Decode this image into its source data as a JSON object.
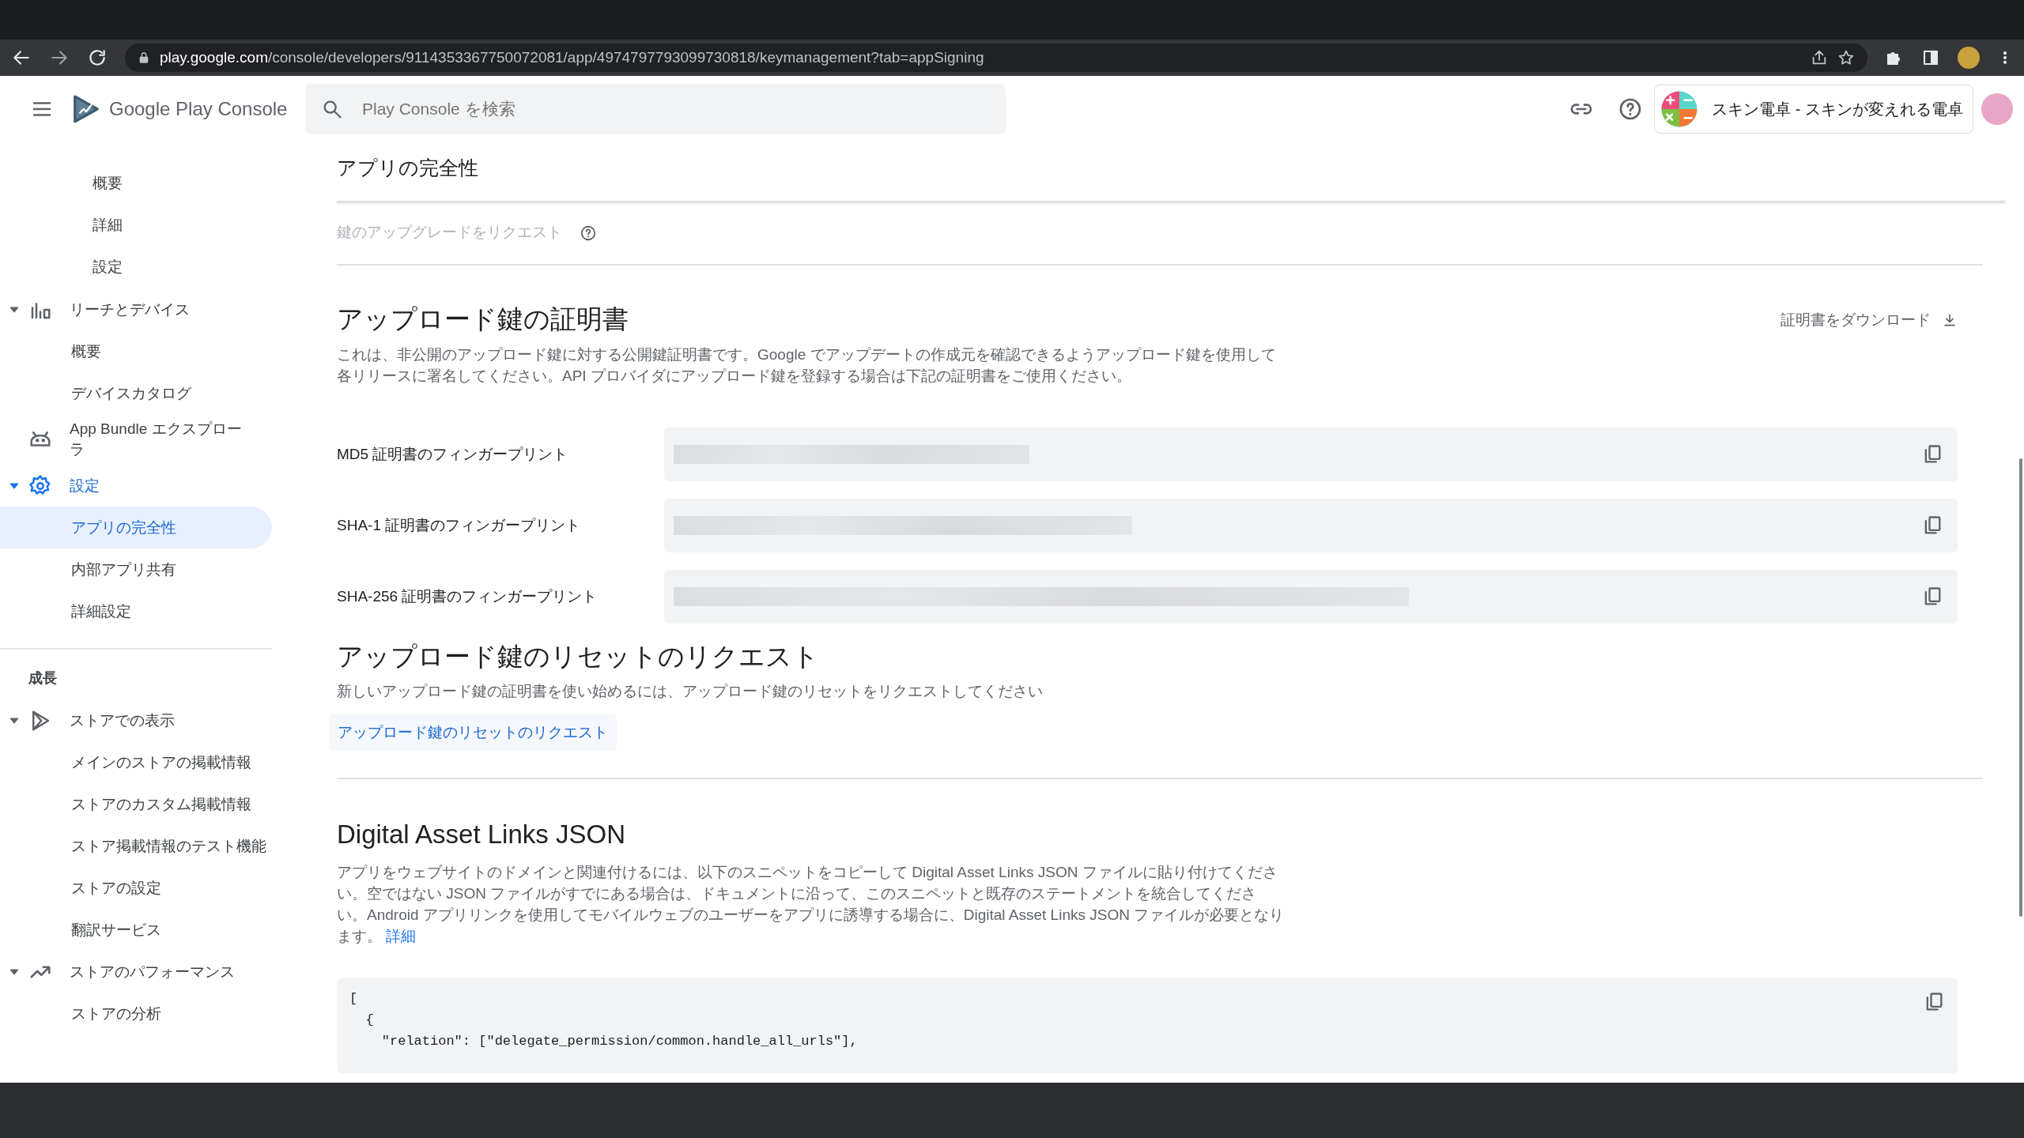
{
  "browser": {
    "url_host": "play.google.com",
    "url_path": "/console/developers/9114353367750072081/app/4974797793099730818/keymanagement?tab=appSigning"
  },
  "header": {
    "product": "Google Play Console",
    "search": {
      "placeholder": "Play Console を検索"
    },
    "app_name": "スキン電卓 - スキンが変えれる電卓"
  },
  "sidebar": {
    "items": [
      {
        "kind": "sub2",
        "label": "概要",
        "selected": false
      },
      {
        "kind": "sub2",
        "label": "詳細",
        "selected": false
      },
      {
        "kind": "sub2",
        "label": "設定",
        "selected": false
      },
      {
        "kind": "group",
        "label": "リーチとデバイス",
        "expanded": true,
        "children": [
          {
            "label": "概要",
            "selected": false
          },
          {
            "label": "デバイスカタログ",
            "selected": false
          }
        ]
      },
      {
        "kind": "group",
        "label": "App Bundle エクスプローラ"
      },
      {
        "kind": "group",
        "label": "設定",
        "expanded": true,
        "children": [
          {
            "label": "アプリの完全性",
            "selected": true
          },
          {
            "label": "内部アプリ共有",
            "selected": false
          },
          {
            "label": "詳細設定",
            "selected": false
          }
        ]
      },
      {
        "kind": "divider"
      },
      {
        "kind": "section",
        "label": "成長"
      },
      {
        "kind": "group",
        "label": "ストアでの表示",
        "expanded": true,
        "children": [
          {
            "label": "メインのストアの掲載情報",
            "selected": false
          },
          {
            "label": "ストアのカスタム掲載情報",
            "selected": false
          },
          {
            "label": "ストア掲載情報のテスト機能",
            "selected": false
          },
          {
            "label": "ストアの設定",
            "selected": false
          },
          {
            "label": "翻訳サービス",
            "selected": false
          }
        ]
      },
      {
        "kind": "group",
        "label": "ストアのパフォーマンス",
        "expanded": true,
        "children": [
          {
            "label": "ストアの分析",
            "selected": false
          }
        ]
      }
    ]
  },
  "page": {
    "title": "アプリの完全性",
    "upgrade_request": {
      "label": "鍵のアップグレードをリクエスト",
      "disabled": true
    },
    "certificate": {
      "heading": "アップロード鍵の証明書",
      "download": "証明書をダウンロード",
      "description": "これは、非公開のアップロード鍵に対する公開鍵証明書です。Google でアップデートの作成元を確認できるようアップロード鍵を使用して各リリースに署名してください。API プロバイダにアップロード鍵を登録する場合は下記の証明書をご使用ください。",
      "fingerprints": [
        {
          "label": "MD5 証明書のフィンガープリント"
        },
        {
          "label": "SHA-1 証明書のフィンガープリント"
        },
        {
          "label": "SHA-256 証明書のフィンガープリント"
        }
      ]
    },
    "reset": {
      "heading": "アップロード鍵のリセットのリクエスト",
      "description": "新しいアップロード鍵の証明書を使い始めるには、アップロード鍵のリセットをリクエストしてください",
      "button": "アップロード鍵のリセットのリクエスト"
    },
    "asset_links": {
      "heading": "Digital Asset Links JSON",
      "description": "アプリをウェブサイトのドメインと関連付けるには、以下のスニペットをコピーして Digital Asset Links JSON ファイルに貼り付けてください。空ではない JSON ファイルがすでにある場合は、ドキュメントに沿って、このスニペットと既存のステートメントを統合してください。Android アプリリンクを使用してモバイルウェブのユーザーをアプリに誘導する場合に、Digital Asset Links JSON ファイルが必要となります。",
      "link": "詳細",
      "code_lines": [
        "[",
        "  {",
        "    \"relation\": [\"delegate_permission/common.handle_all_urls\"],"
      ]
    }
  }
}
